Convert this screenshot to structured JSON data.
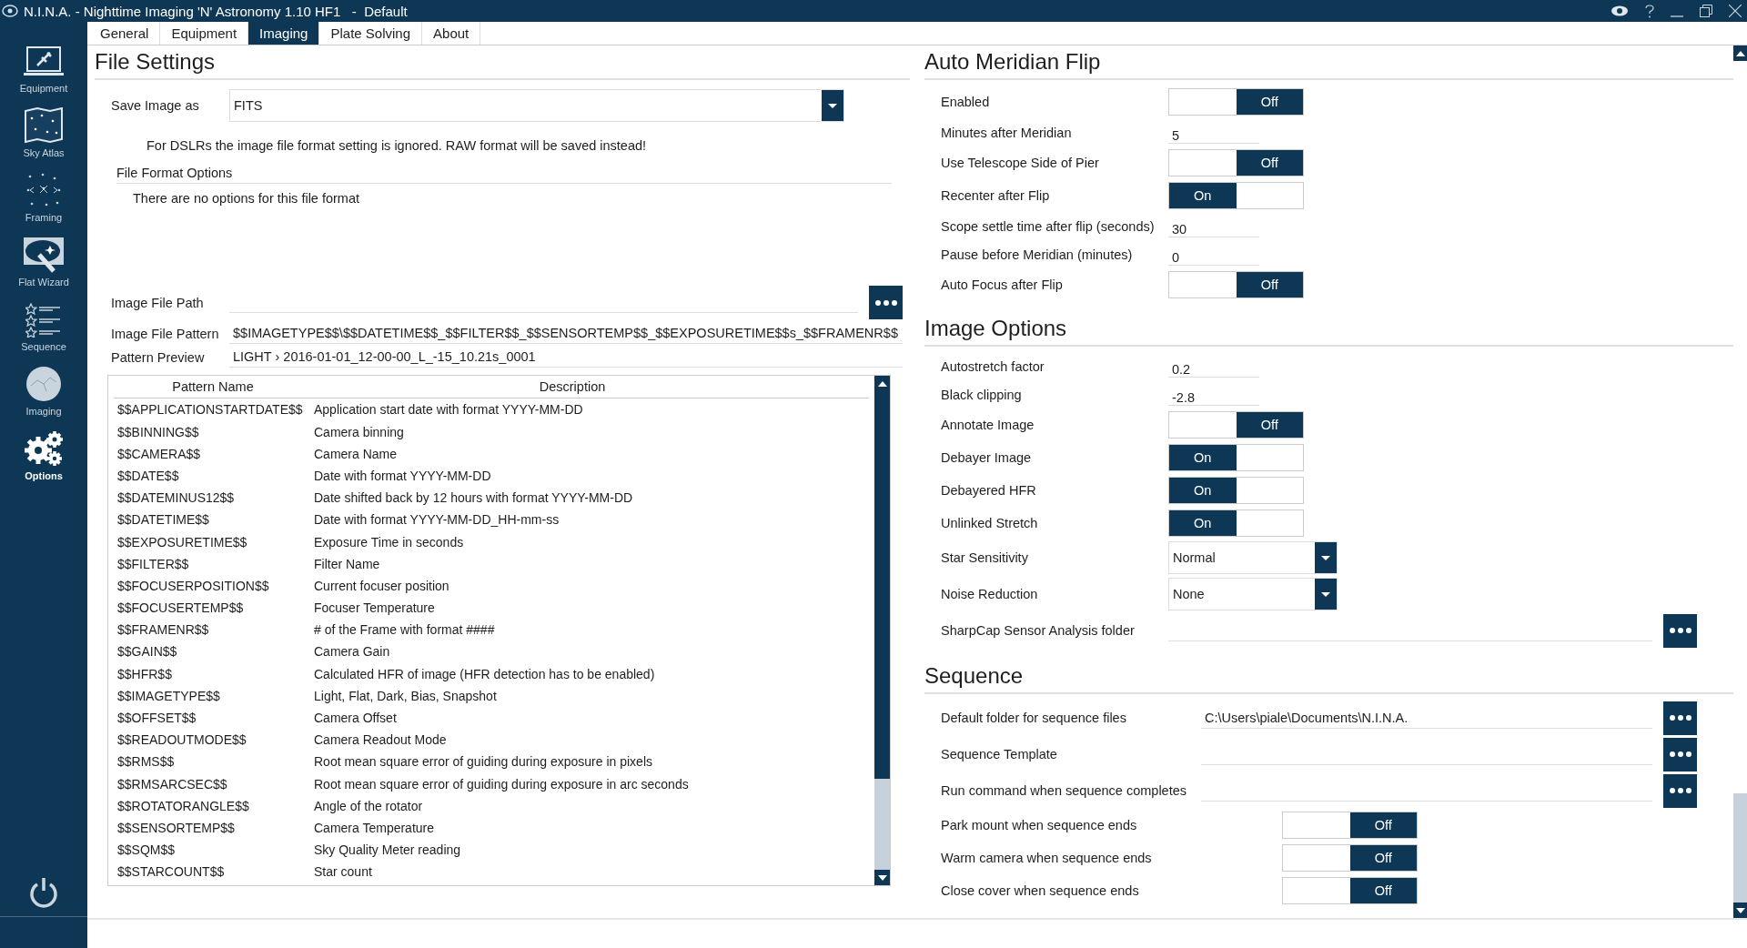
{
  "window": {
    "title": "N.I.N.A. - Nighttime Imaging 'N' Astronomy 1.10 HF1   -  Default"
  },
  "sidebar": {
    "items": [
      {
        "label": "Equipment",
        "selected": false
      },
      {
        "label": "Sky Atlas",
        "selected": false
      },
      {
        "label": "Framing",
        "selected": false
      },
      {
        "label": "Flat Wizard",
        "selected": false
      },
      {
        "label": "Sequence",
        "selected": false
      },
      {
        "label": "Imaging",
        "selected": false
      },
      {
        "label": "Options",
        "selected": true
      }
    ]
  },
  "tabs": [
    {
      "label": "General",
      "selected": false
    },
    {
      "label": "Equipment",
      "selected": false
    },
    {
      "label": "Imaging",
      "selected": true
    },
    {
      "label": "Plate Solving",
      "selected": false
    },
    {
      "label": "About",
      "selected": false
    }
  ],
  "file_settings": {
    "title": "File Settings",
    "save_image_as": {
      "label": "Save Image as",
      "value": "FITS"
    },
    "dslr_note": "For DSLRs the image file format setting is ignored. RAW format will be saved instead!",
    "format_options": {
      "title": "File Format Options",
      "note": "There are no options for this file format"
    },
    "image_file_path": {
      "label": "Image File Path"
    },
    "image_file_pattern": {
      "label": "Image File Pattern",
      "value": "$$IMAGETYPE$$\\$$DATETIME$$_$$FILTER$$_$$SENSORTEMP$$_$$EXPOSURETIME$$s_$$FRAMENR$$"
    },
    "pattern_preview": {
      "label": "Pattern Preview",
      "value": "LIGHT › 2016-01-01_12-00-00_L_-15_10.21s_0001"
    },
    "pattern_table": {
      "columns": [
        "Pattern Name",
        "Description"
      ],
      "rows": [
        {
          "name": "$$APPLICATIONSTARTDATE$$",
          "description": "Application start date with format YYYY-MM-DD"
        },
        {
          "name": "$$BINNING$$",
          "description": "Camera binning"
        },
        {
          "name": "$$CAMERA$$",
          "description": "Camera Name"
        },
        {
          "name": "$$DATE$$",
          "description": "Date with format YYYY-MM-DD"
        },
        {
          "name": "$$DATEMINUS12$$",
          "description": "Date shifted back by 12 hours with format YYYY-MM-DD"
        },
        {
          "name": "$$DATETIME$$",
          "description": "Date with format YYYY-MM-DD_HH-mm-ss"
        },
        {
          "name": "$$EXPOSURETIME$$",
          "description": "Exposure Time in seconds"
        },
        {
          "name": "$$FILTER$$",
          "description": "Filter Name"
        },
        {
          "name": "$$FOCUSERPOSITION$$",
          "description": "Current focuser position"
        },
        {
          "name": "$$FOCUSERTEMP$$",
          "description": "Focuser Temperature"
        },
        {
          "name": "$$FRAMENR$$",
          "description": "# of the Frame with format ####"
        },
        {
          "name": "$$GAIN$$",
          "description": "Camera Gain"
        },
        {
          "name": "$$HFR$$",
          "description": "Calculated HFR of image (HFR detection has to be enabled)"
        },
        {
          "name": "$$IMAGETYPE$$",
          "description": "Light, Flat, Dark, Bias, Snapshot"
        },
        {
          "name": "$$OFFSET$$",
          "description": "Camera Offset"
        },
        {
          "name": "$$READOUTMODE$$",
          "description": "Camera Readout Mode"
        },
        {
          "name": "$$RMS$$",
          "description": "Root mean square error of guiding during exposure in pixels"
        },
        {
          "name": "$$RMSARCSEC$$",
          "description": "Root mean square error of guiding during exposure in arc seconds"
        },
        {
          "name": "$$ROTATORANGLE$$",
          "description": "Angle of the rotator"
        },
        {
          "name": "$$SENSORTEMP$$",
          "description": "Camera Temperature"
        },
        {
          "name": "$$SQM$$",
          "description": "Sky Quality Meter reading"
        },
        {
          "name": "$$STARCOUNT$$",
          "description": "Star count"
        }
      ]
    }
  },
  "sections": [
    {
      "title": "Auto Meridian Flip",
      "rows": [
        {
          "kind": "toggle",
          "label": "Enabled",
          "on": false,
          "state_label": "Off"
        },
        {
          "kind": "text",
          "label": "Minutes after Meridian",
          "value": "5"
        },
        {
          "kind": "toggle",
          "label": "Use Telescope Side of Pier",
          "on": false,
          "state_label": "Off"
        },
        {
          "kind": "toggle",
          "label": "Recenter after Flip",
          "on": true,
          "state_label": "On"
        },
        {
          "kind": "text",
          "label": "Scope settle time after flip (seconds)",
          "value": "30"
        },
        {
          "kind": "text",
          "label": "Pause before Meridian (minutes)",
          "value": "0"
        },
        {
          "kind": "toggle",
          "label": "Auto Focus after Flip",
          "on": false,
          "state_label": "Off"
        }
      ]
    },
    {
      "title": "Image Options",
      "rows": [
        {
          "kind": "text",
          "label": "Autostretch factor",
          "value": "0.2"
        },
        {
          "kind": "text",
          "label": "Black clipping",
          "value": "-2.8"
        },
        {
          "kind": "toggle",
          "label": "Annotate Image",
          "on": false,
          "state_label": "Off"
        },
        {
          "kind": "toggle",
          "label": "Debayer Image",
          "on": true,
          "state_label": "On"
        },
        {
          "kind": "toggle",
          "label": "Debayered HFR",
          "on": true,
          "state_label": "On"
        },
        {
          "kind": "toggle",
          "label": "Unlinked Stretch",
          "on": true,
          "state_label": "On"
        },
        {
          "kind": "dropdown",
          "label": "Star Sensitivity",
          "value": "Normal"
        },
        {
          "kind": "dropdown",
          "label": "Noise Reduction",
          "value": "None"
        },
        {
          "kind": "path",
          "label": "SharpCap Sensor Analysis folder"
        }
      ]
    },
    {
      "title": "Sequence",
      "rows": [
        {
          "kind": "path",
          "label": "Default folder for sequence files",
          "value": "C:\\Users\\piale\\Documents\\N.I.N.A."
        },
        {
          "kind": "path",
          "label": "Sequence Template"
        },
        {
          "kind": "path",
          "label": "Run command when sequence completes"
        },
        {
          "kind": "toggle",
          "label": "Park mount when sequence ends",
          "on": false,
          "state_label": "Off"
        },
        {
          "kind": "toggle",
          "label": "Warm camera when sequence ends",
          "on": false,
          "state_label": "Off"
        },
        {
          "kind": "toggle",
          "label": "Close cover when sequence ends",
          "on": false,
          "state_label": "Off"
        }
      ]
    }
  ]
}
